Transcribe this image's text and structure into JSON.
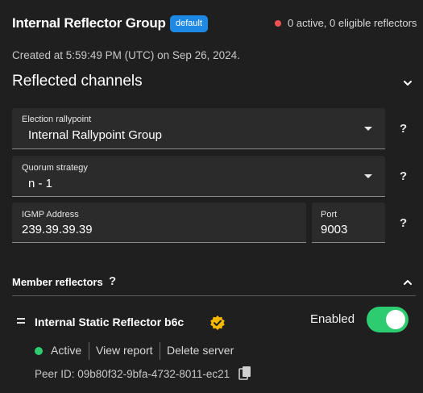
{
  "header": {
    "title": "Internal Reflector Group",
    "badge": "default",
    "status_text": "0 active, 0 eligible reflectors",
    "status_color": "#ef5350"
  },
  "created_text": "Created at 5:59:49 PM (UTC) on Sep 26, 2024.",
  "reflected": {
    "title": "Reflected channels",
    "expanded_icon": "chevron-down-icon"
  },
  "fields": {
    "election": {
      "label": "Election rallypoint",
      "value": "Internal Rallypoint Group"
    },
    "quorum": {
      "label": "Quorum strategy",
      "value": "n - 1"
    },
    "igmp": {
      "label": "IGMP Address",
      "value": "239.39.39.39"
    },
    "port": {
      "label": "Port",
      "value": "9003"
    },
    "help": "?"
  },
  "members": {
    "title": "Member reflectors",
    "help": "?",
    "collapse_icon": "chevron-up-icon",
    "items": [
      {
        "name": "Internal Static Reflector b6c",
        "enabled_label": "Enabled",
        "enabled": true,
        "status": "Active",
        "view_report": "View report",
        "delete": "Delete server",
        "peer_id": "Peer ID: 09b80f32-9bfa-4732-8011-ec21"
      }
    ]
  },
  "colors": {
    "accent": "#1e88e5",
    "active": "#2ecc71",
    "verified": "#f5b800",
    "background": "#1f1f1f"
  }
}
